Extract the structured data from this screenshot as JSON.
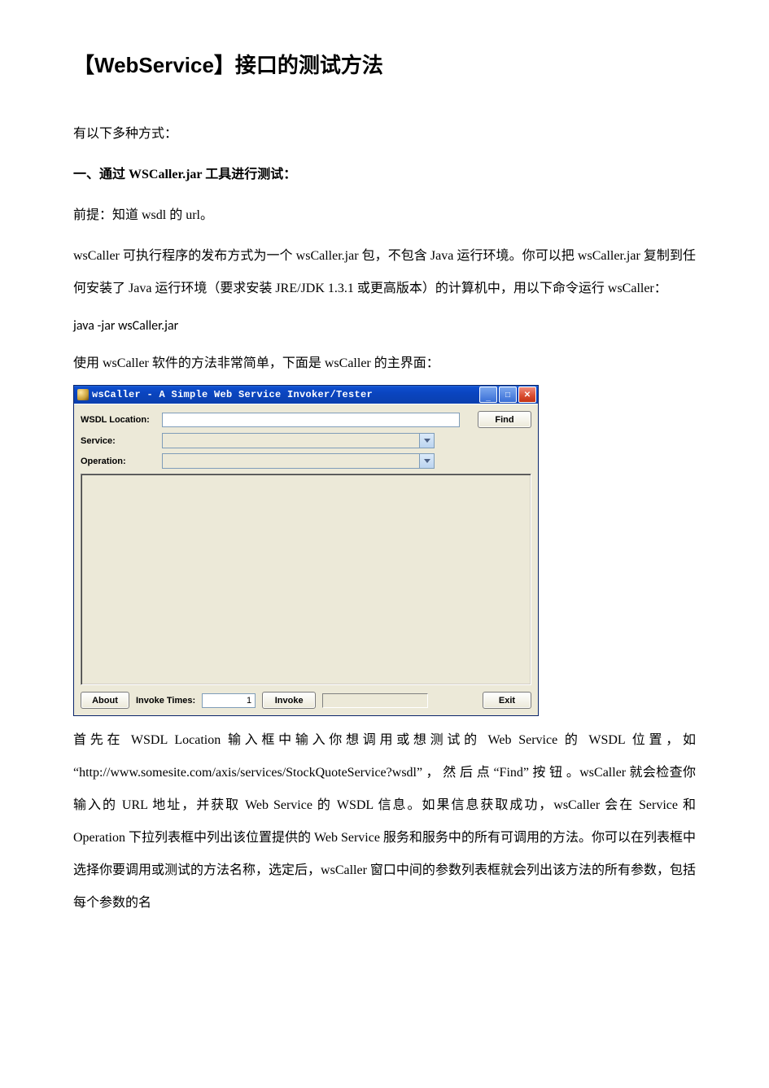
{
  "heading": "【WebService】接口的测试方法",
  "p1": "有以下多种方式：",
  "p2": "一、通过 WSCaller.jar 工具进行测试：",
  "p3": "前提：知道 wsdl 的 url。",
  "p4": "wsCaller 可执行程序的发布方式为一个 wsCaller.jar 包，不包含 Java 运行环境。你可以把 wsCaller.jar 复制到任何安装了 Java 运行环境（要求安装 JRE/JDK  1.3.1 或更高版本）的计算机中，用以下命令运行 wsCaller：",
  "p5": "java -jar wsCaller.jar",
  "p6": "使用 wsCaller 软件的方法非常简单，下面是 wsCaller 的主界面：",
  "p7": "首先在 WSDL  Location 输入框中输入你想调用或想测试的 Web  Service 的 WSDL 位置，如 “http://www.somesite.com/axis/services/StockQuoteService?wsdl” ， 然 后 点 “Find” 按 钮 。wsCaller 就会检查你输入的 URL 地址，并获取 Web  Service 的 WSDL 信息。如果信息获取成功，wsCaller 会在 Service 和 Operation 下拉列表框中列出该位置提供的 Web  Service 服务和服务中的所有可调用的方法。你可以在列表框中选择你要调用或测试的方法名称，选定后，wsCaller 窗口中间的参数列表框就会列出该方法的所有参数，包括每个参数的名",
  "app": {
    "title": "wsCaller - A Simple Web Service Invoker/Tester",
    "labels": {
      "wsdl": "WSDL Location:",
      "service": "Service:",
      "operation": "Operation:",
      "invoke_times": "Invoke Times:"
    },
    "buttons": {
      "find": "Find",
      "about": "About",
      "invoke": "Invoke",
      "exit": "Exit"
    },
    "inputs": {
      "wsdl_value": "",
      "invoke_times_value": "1"
    },
    "win_icons": {
      "min": "_",
      "max": "□",
      "close": "✕"
    }
  }
}
